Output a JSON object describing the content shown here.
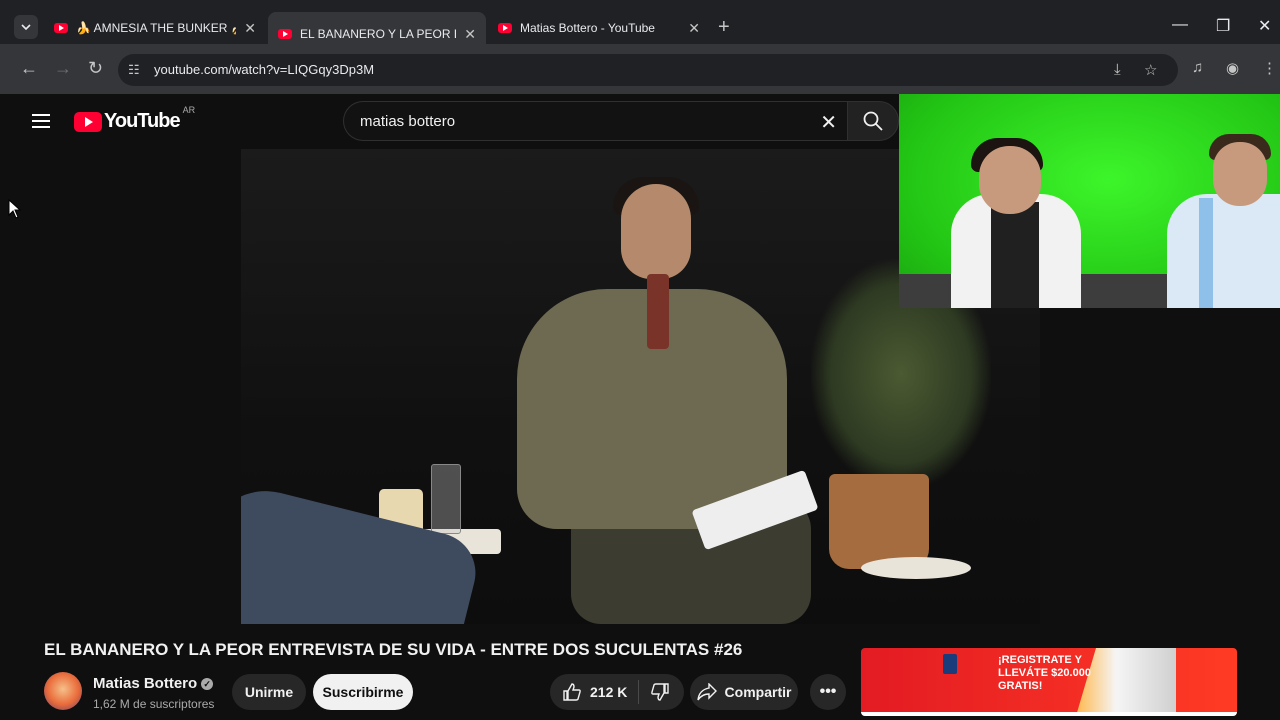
{
  "browser": {
    "tabs": [
      {
        "title": "🍌 AMNESIA THE BUNKER 🍌 GU",
        "active": false
      },
      {
        "title": "EL BANANERO Y LA PEOR ENTI",
        "active": true
      },
      {
        "title": "Matias Bottero - YouTube",
        "active": false
      }
    ],
    "new_tab": "+",
    "url": "youtube.com/watch?v=LIQGqy3Dp3M",
    "window_controls": {
      "minimize": "—",
      "restore": "❐",
      "close": "✕"
    }
  },
  "youtube": {
    "logo_text": "YouTube",
    "region": "AR",
    "search": {
      "value": "matias bottero"
    }
  },
  "video": {
    "title": "EL BANANERO Y LA PEOR ENTREVISTA DE SU VIDA - ENTRE DOS SUCULENTAS #26"
  },
  "channel": {
    "name": "Matias Bottero",
    "subscribers": "1,62 M de suscriptores",
    "verified_mark": "✓"
  },
  "actions": {
    "join": "Unirme",
    "subscribe": "Suscribirme",
    "likes": "212 K",
    "share": "Compartir",
    "more": "•••"
  },
  "ad": {
    "text": "¡REGISTRATE Y\nLLEVÁTE $20.000\nGRATIS!"
  },
  "icons": [
    "tab-search-icon",
    "youtube-favicon",
    "close-icon",
    "back-icon",
    "forward-icon",
    "reload-icon",
    "site-info-icon",
    "install-icon",
    "bookmark-star-icon",
    "media-icon",
    "profile-icon",
    "menu-icon",
    "hamburger-icon",
    "search-icon",
    "clear-icon",
    "like-icon",
    "dislike-icon",
    "share-icon",
    "more-icon",
    "mouse-cursor-icon"
  ]
}
